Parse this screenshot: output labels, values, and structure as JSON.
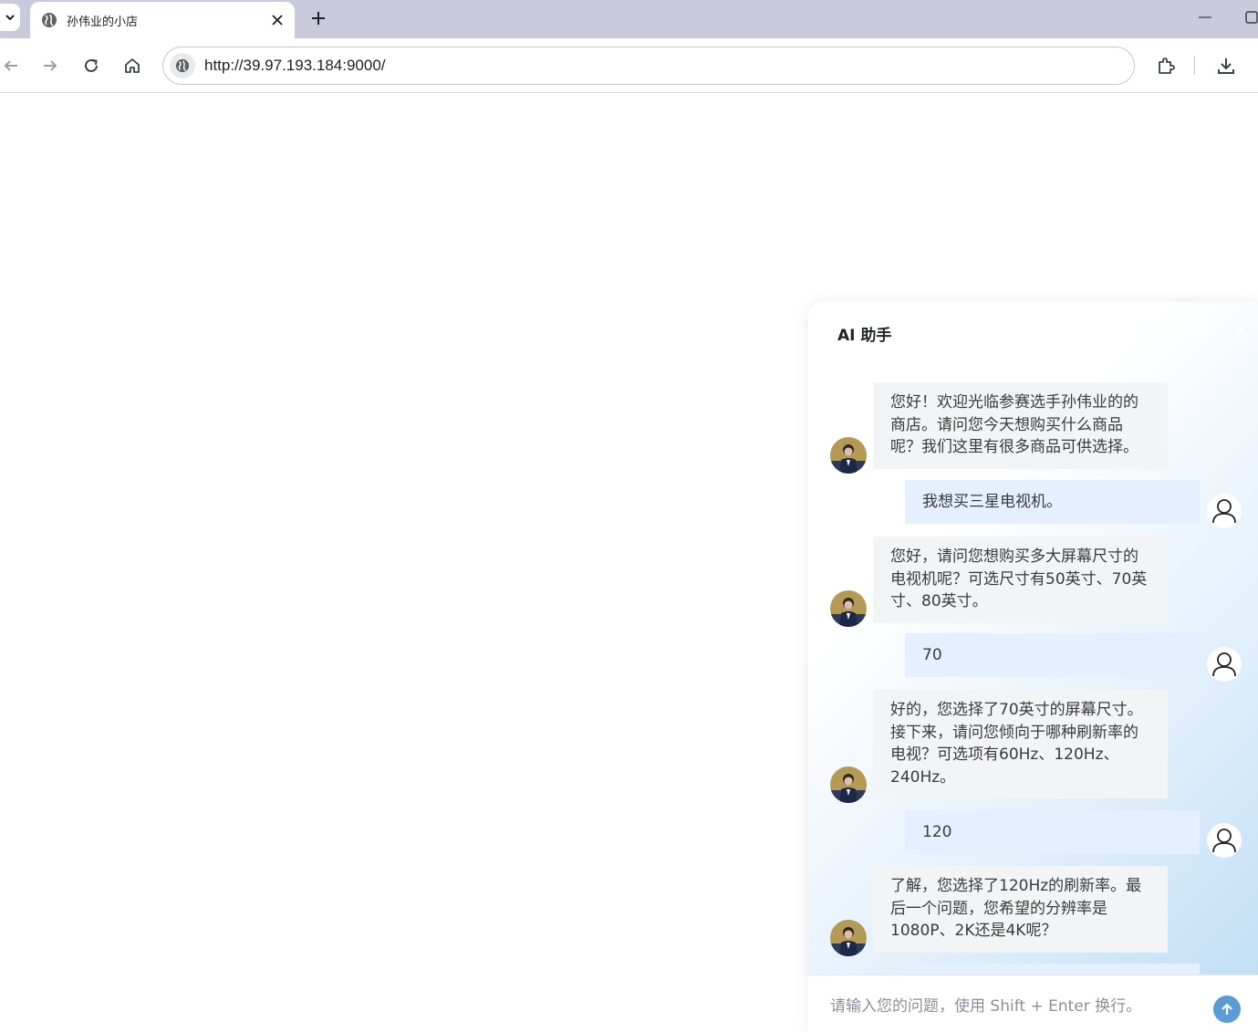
{
  "browser": {
    "tab_title": "孙伟业的小店",
    "url": "http://39.97.193.184:9000/"
  },
  "chat": {
    "title": "AI 助手",
    "messages": [
      {
        "role": "ai",
        "text": "您好！欢迎光临参赛选手孙伟业的的商店。请问您今天想购买什么商品呢？我们这里有很多商品可供选择。"
      },
      {
        "role": "user",
        "text": "我想买三星电视机。"
      },
      {
        "role": "ai",
        "text": "您好，请问您想购买多大屏幕尺寸的电视机呢？可选尺寸有50英寸、70英寸、80英寸。"
      },
      {
        "role": "user",
        "text": "70"
      },
      {
        "role": "ai",
        "text": "好的，您选择了70英寸的屏幕尺寸。接下来，请问您倾向于哪种刷新率的电视？可选项有60Hz、120Hz、240Hz。"
      },
      {
        "role": "user",
        "text": "120"
      },
      {
        "role": "ai",
        "text": "了解，您选择了120Hz的刷新率。最后一个问题，您希望的分辨率是1080P、2K还是4K呢？"
      }
    ],
    "input_placeholder": "请输入您的问题，使用 Shift + Enter 换行。"
  },
  "colors": {
    "ai_bubble": "#f3f4f5",
    "user_bubble": "#e4efff",
    "send_button": "#5b9bd5"
  }
}
